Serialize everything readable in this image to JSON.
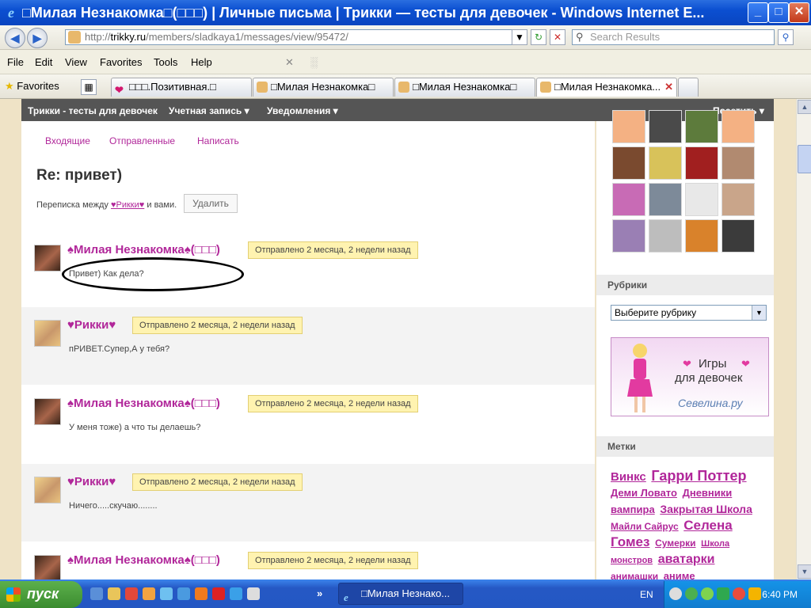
{
  "window": {
    "title": "□Милая Незнакомка□(□□□) | Личные письма | Трикки — тесты для девочек - Windows Internet E...",
    "minimize": "_",
    "maximize": "□",
    "close": "✕"
  },
  "address": {
    "url_prefix": "http://",
    "url_domain": "trikky.ru",
    "url_path": "/members/sladkaya1/messages/view/95472/",
    "search_placeholder": "Search Results"
  },
  "menu": [
    "File",
    "Edit",
    "View",
    "Favorites",
    "Tools",
    "Help"
  ],
  "favorites": {
    "label": "Favorites",
    "tabs": [
      {
        "label": "□□□.Позитивная.□",
        "active": false
      },
      {
        "label": "□Милая Незнакомка□",
        "active": false
      },
      {
        "label": "□Милая Незнакомка□",
        "active": false
      },
      {
        "label": "□Милая Незнакомка...",
        "active": true
      }
    ]
  },
  "site": {
    "brand": "Трикки - тесты для девочек",
    "account": "Учетная запись ▾",
    "notifications": "Уведомления ▾",
    "visit": "Посетить ▾"
  },
  "subnav": [
    "Входящие",
    "Отправленные",
    "Написать"
  ],
  "thread": {
    "title": "Re: привет)",
    "between_prefix": "Переписка между",
    "between_user": "♥Рикки♥",
    "between_suffix": "и вами.",
    "delete_label": "Удалить"
  },
  "messages": [
    {
      "author": "♠Милая Незнакомка♠(□□□)",
      "sent": "Отправлено 2 месяца, 2 недели назад",
      "text": "Привет) Как дела?"
    },
    {
      "author": "♥Рикки♥",
      "sent": "Отправлено 2 месяца, 2 недели назад",
      "text": "пРИВЕТ.Супер,А у тебя?"
    },
    {
      "author": "♠Милая Незнакомка♠(□□□)",
      "sent": "Отправлено 2 месяца, 2 недели назад",
      "text": "У меня тоже) а что ты делаешь?"
    },
    {
      "author": "♥Рикки♥",
      "sent": "Отправлено 2 месяца, 2 недели назад",
      "text": "Ничего.....скучаю........"
    },
    {
      "author": "♠Милая Незнакомка♠(□□□)",
      "sent": "Отправлено 2 месяца, 2 недели назад",
      "text": ""
    }
  ],
  "sidebar": {
    "rubrics_title": "Рубрики",
    "rubrics_select": "Выберите рубрику",
    "banner_line1": "Игры",
    "banner_line2": "для девочек",
    "banner_line3": "Севелина.ру",
    "tags_title": "Метки",
    "tags": [
      "Винкс",
      "Гарри Поттер",
      "Деми Ловато",
      "Дневники вампира",
      "Закрытая Школа",
      "Майли Сайрус",
      "Селена Гомез",
      "Сумерки",
      "Школа монстров",
      "аватарки",
      "анимашки",
      "аниме"
    ]
  },
  "taskbar": {
    "start": "пуск",
    "task": "□Милая Незнако...",
    "lang": "EN",
    "clock": "6:40 PM"
  }
}
